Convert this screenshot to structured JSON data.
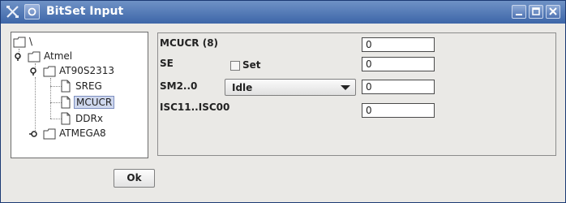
{
  "window": {
    "title": "BitSet Input",
    "titlebar_color": "#4c72b0"
  },
  "tree": {
    "root": {
      "label": "\\"
    },
    "nodes": [
      {
        "label": "Atmel",
        "type": "folder",
        "expanded": true
      },
      {
        "label": "AT90S2313",
        "type": "folder",
        "expanded": true
      },
      {
        "label": "SREG",
        "type": "file"
      },
      {
        "label": "MCUCR",
        "type": "file",
        "selected": true
      },
      {
        "label": "DDRx",
        "type": "file"
      },
      {
        "label": "ATMEGA8",
        "type": "folder",
        "expanded": false
      }
    ]
  },
  "form": {
    "title": "MCUCR (8)",
    "title_value": "0",
    "se_label": "SE",
    "se_checkbox_label": "Set",
    "se_checked": false,
    "se_value": "0",
    "sm_label": "SM2..0",
    "sm_selected": "Idle",
    "sm_value": "0",
    "isc_label": "ISC11..ISC00",
    "isc_value": "0"
  },
  "buttons": {
    "ok": "Ok"
  },
  "icons": {
    "app": "tools-x-icon",
    "system_menu": "system-menu-icon",
    "minimize": "minimize-icon",
    "maximize": "maximize-icon",
    "close": "close-icon",
    "folder": "folder-icon",
    "file": "file-icon"
  }
}
